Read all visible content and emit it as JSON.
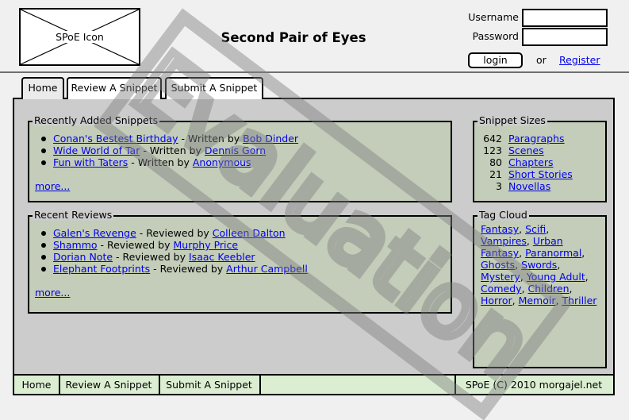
{
  "header": {
    "logo_label": "SPoE Icon",
    "title": "Second Pair of Eyes",
    "username_label": "Username",
    "password_label": "Password",
    "login_label": "login",
    "or_text": "or",
    "register_label": "Register"
  },
  "tabs": [
    {
      "label": "Home"
    },
    {
      "label": "Review A Snippet"
    },
    {
      "label": "Submit A Snippet"
    }
  ],
  "recent_snippets": {
    "title": "Recently Added Snippets",
    "items": [
      {
        "title": "Conan's Bestest Birthday",
        "sep": " - Written by ",
        "author": "Bob Dinder"
      },
      {
        "title": "Wide World of Tar",
        "sep": " - Written by ",
        "author": "Dennis Gorn"
      },
      {
        "title": "Fun with Taters",
        "sep": " - Written by ",
        "author": "Anonymous"
      }
    ],
    "more": "more..."
  },
  "recent_reviews": {
    "title": "Recent Reviews",
    "items": [
      {
        "title": "Galen's Revenge",
        "sep": " - Reviewed by ",
        "author": "Colleen Dalton"
      },
      {
        "title": "Shammo",
        "sep": " - Reviewed by ",
        "author": "Murphy Price"
      },
      {
        "title": "Dorian Note",
        "sep": " - Reviewed by ",
        "author": "Isaac Keebler"
      },
      {
        "title": "Elephant Footprints",
        "sep": " - Reviewed by ",
        "author": "Arthur Campbell"
      }
    ],
    "more": "more..."
  },
  "snippet_sizes": {
    "title": "Snippet Sizes",
    "rows": [
      {
        "count": "642",
        "label": "Paragraphs"
      },
      {
        "count": "123",
        "label": "Scenes"
      },
      {
        "count": "80",
        "label": "Chapters"
      },
      {
        "count": "21",
        "label": "Short Stories"
      },
      {
        "count": "3",
        "label": "Novellas"
      }
    ]
  },
  "tag_cloud": {
    "title": "Tag Cloud",
    "tags": [
      "Fantasy",
      "Scifi",
      "Vampires",
      "Urban Fantasy",
      "Paranormal",
      "Ghosts",
      "Swords",
      "Mystery",
      "Young Adult",
      "Comedy",
      "Children",
      "Horror",
      "Memoir",
      "Thriller"
    ]
  },
  "footer": {
    "home": "Home",
    "review": "Review A Snippet",
    "submit": "Submit A Snippet",
    "copyright": "SPoE (C) 2010 morgajel.net"
  },
  "watermark": {
    "text": "Evaluation",
    "color": "#808080"
  },
  "colors": {
    "panel_bg": "#c3cdb9",
    "main_bg": "#cccccc",
    "footer_bg": "#dbeed2",
    "link": "#0000ee"
  }
}
